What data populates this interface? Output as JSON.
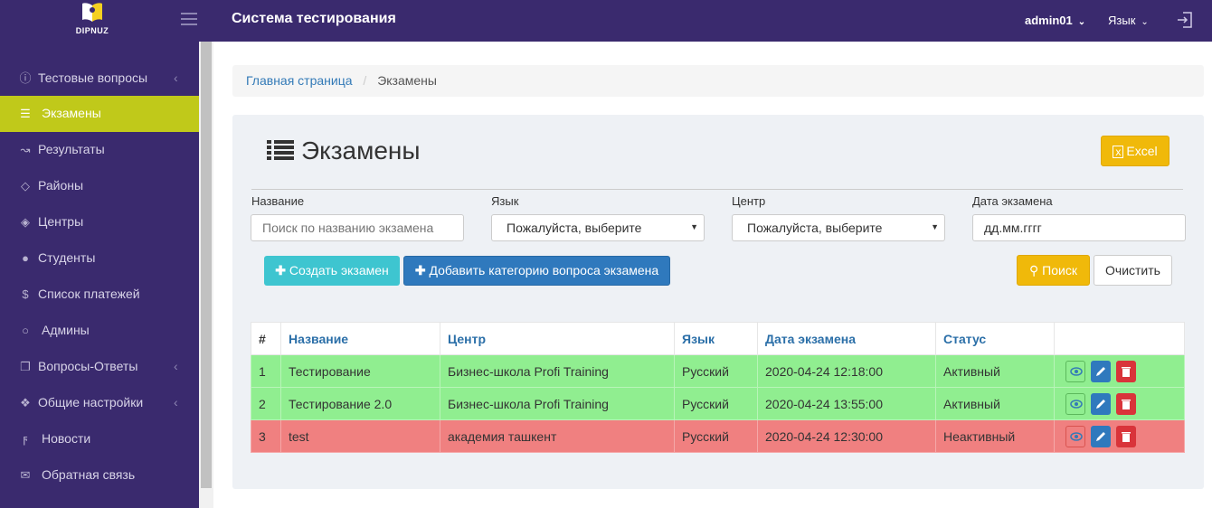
{
  "header": {
    "logo_text": "DIPNUZ",
    "app_title": "Система тестирования",
    "user": "admin01",
    "language": "Язык"
  },
  "sidebar": {
    "items": [
      {
        "label": "Тестовые вопросы",
        "icon": "question-circle-icon",
        "has_submenu": true
      },
      {
        "label": "Экзамены",
        "icon": "list-icon",
        "active": true
      },
      {
        "label": "Результаты",
        "icon": "line-chart-icon"
      },
      {
        "label": "Районы",
        "icon": "layers-icon"
      },
      {
        "label": "Центры",
        "icon": "graduation-cap-icon"
      },
      {
        "label": "Студенты",
        "icon": "users-icon"
      },
      {
        "label": "Список платежей",
        "icon": "dollar-icon"
      },
      {
        "label": "Админы",
        "icon": "user-icon"
      },
      {
        "label": "Вопросы-Ответы",
        "icon": "copy-icon",
        "has_submenu": true
      },
      {
        "label": "Общие настройки",
        "icon": "info-circle-icon",
        "has_submenu": true
      },
      {
        "label": "Новости",
        "icon": "bolt-icon"
      },
      {
        "label": "Обратная связь",
        "icon": "comments-icon"
      }
    ]
  },
  "breadcrumb": {
    "home": "Главная страница",
    "current": "Экзамены"
  },
  "page": {
    "title": "Экзамены",
    "excel_label": "Excel"
  },
  "filters": {
    "name_label": "Название",
    "name_placeholder": "Поиск по названию экзамена",
    "lang_label": "Язык",
    "lang_value": "Пожалуйста, выберите",
    "center_label": "Центр",
    "center_value": "Пожалуйста, выберите",
    "date_label": "Дата экзамена",
    "date_placeholder": "дд.мм.гггг"
  },
  "actions": {
    "create_label": "Создать экзамен",
    "add_category_label": "Добавить категорию вопроса экзамена",
    "search_label": "Поиск",
    "clear_label": "Очистить"
  },
  "table": {
    "columns": [
      "#",
      "Название",
      "Центр",
      "Язык",
      "Дата экзамена",
      "Статус",
      ""
    ],
    "rows": [
      {
        "num": "1",
        "name": "Тестирование",
        "center": "Бизнес-школа Profi Training",
        "lang": "Русский",
        "date": "2020-04-24 12:18:00",
        "status": "Активный",
        "state": "active"
      },
      {
        "num": "2",
        "name": "Тестирование 2.0",
        "center": "Бизнес-школа Profi Training",
        "lang": "Русский",
        "date": "2020-04-24 13:55:00",
        "status": "Активный",
        "state": "active"
      },
      {
        "num": "3",
        "name": "test",
        "center": "академия ташкент",
        "lang": "Русский",
        "date": "2020-04-24 12:30:00",
        "status": "Неактивный",
        "state": "inactive"
      }
    ]
  },
  "colors": {
    "sidebar_bg": "#3a2a6e",
    "active_item": "#c0c91a",
    "row_active": "#90ee90",
    "row_inactive": "#f08080",
    "excel_button": "#f0b90a"
  }
}
